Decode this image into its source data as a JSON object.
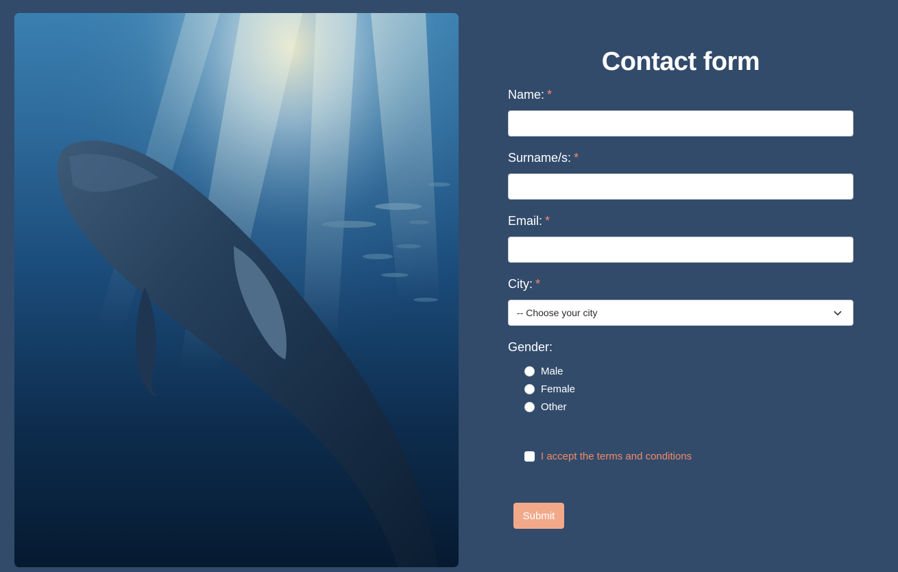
{
  "form": {
    "title": "Contact form",
    "required_mark": "*",
    "name_label": "Name:",
    "name_value": "",
    "surname_label": "Surname/s:",
    "surname_value": "",
    "email_label": "Email:",
    "email_value": "",
    "city_label": "City:",
    "city_selected": "-- Choose your city",
    "gender_label": "Gender:",
    "gender_options": [
      "Male",
      "Female",
      "Other"
    ],
    "gender_selected": null,
    "terms_label": "I accept the terms and conditions",
    "terms_checked": false,
    "submit_label": "Submit"
  },
  "colors": {
    "page_background": "#324b6b",
    "accent": "#f28b6b",
    "submit_background": "#f2a98a",
    "text": "#ffffff"
  }
}
